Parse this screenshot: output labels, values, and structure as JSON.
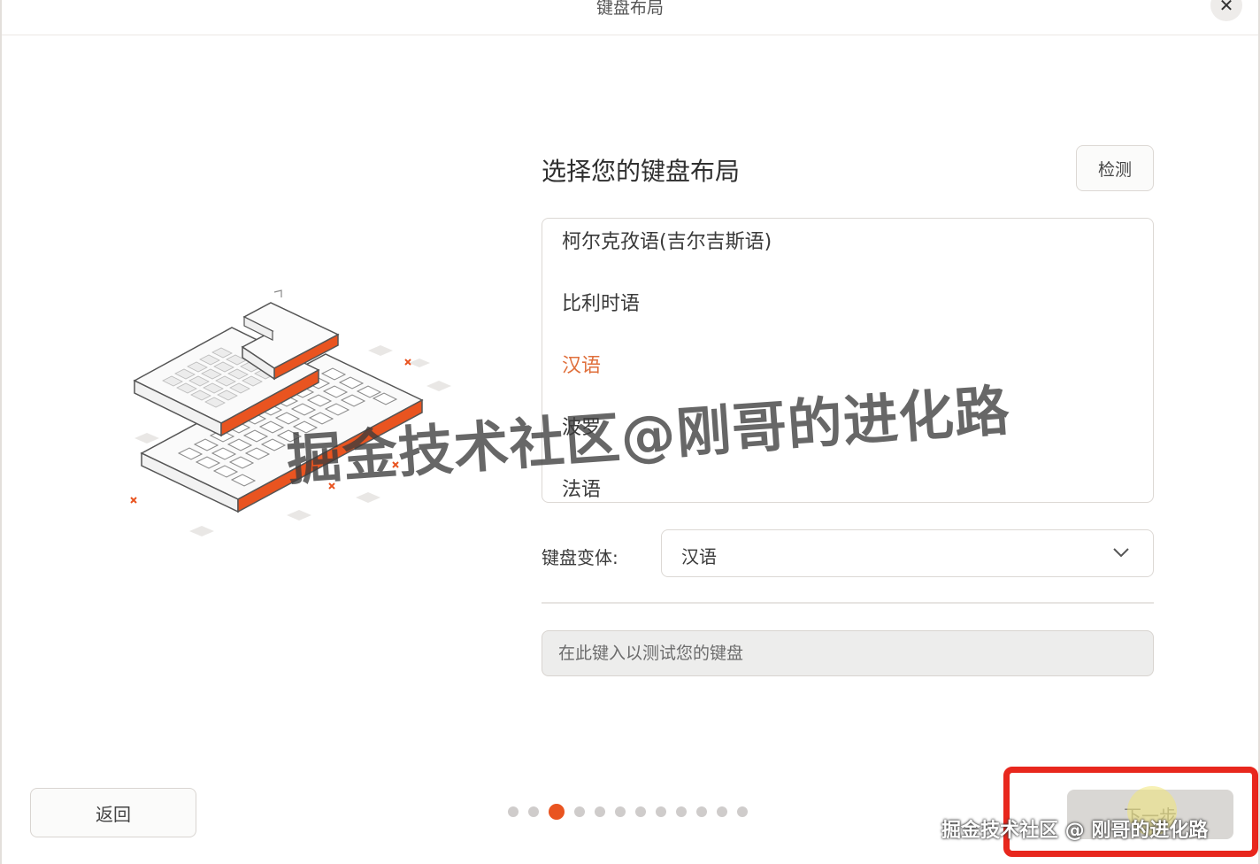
{
  "window": {
    "title": "键盘布局",
    "close_glyph": "✕"
  },
  "main": {
    "heading": "选择您的键盘布局",
    "detect_label": "检测",
    "layouts": [
      {
        "label": "柯尔克孜语(吉尔吉斯语)",
        "selected": false
      },
      {
        "label": "比利时语",
        "selected": false
      },
      {
        "label": "汉语",
        "selected": true
      },
      {
        "label": "波罗",
        "selected": false
      },
      {
        "label": "法语",
        "selected": false
      }
    ],
    "variant_label": "键盘变体:",
    "variant_value": "汉语",
    "test_placeholder": "在此键入以测试您的键盘"
  },
  "footer": {
    "back_label": "返回",
    "next_label": "下一步",
    "page_dots": 12,
    "active_page": 3
  },
  "watermarks": {
    "main": "掘金技术社区@刚哥的进化路",
    "corner": "掘金技术社区 @ 刚哥的进化路"
  },
  "colors": {
    "accent": "#e95420",
    "selected_text": "#e0703c",
    "highlight_box": "#e8271d"
  },
  "icons": {
    "close": "close-icon",
    "chevron": "chevron-down-icon",
    "illustration": "keyboard-illustration"
  }
}
